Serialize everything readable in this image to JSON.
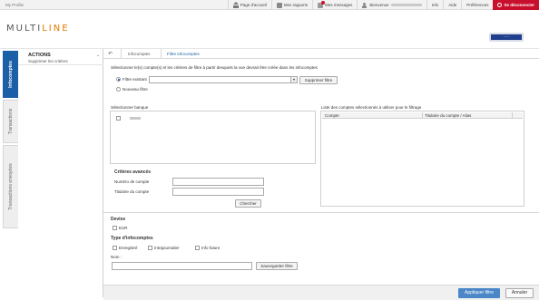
{
  "topbar": {
    "profile": "My Profile",
    "nav": [
      "Page d'accueil",
      "Mes rapports",
      "Mes messages",
      "Bienvenue",
      "Info",
      "Aide",
      "Préférences",
      "Se déconnecter"
    ]
  },
  "brand": {
    "part1": "MULTI",
    "part2": "LINE",
    "accent_color": "#e07b00",
    "button": "······"
  },
  "tabs": [
    "Infocomptes",
    "Transactions",
    "Transactions envoyées"
  ],
  "actions": {
    "title": "ACTIONS",
    "subtitle": "Supprimer les critères"
  },
  "breadcrumb": {
    "back": "↶",
    "items": [
      "Infocomptes",
      "Filtre Infocomptes"
    ]
  },
  "form": {
    "intro": "Sélectionner le(s) compte(s) et les critères de filtre à partir desquels la vue devrait être créée dans les infocomptes",
    "radio_existing": "Filtre existant",
    "radio_new": "Nouveau filtre",
    "filter_select_value": "",
    "delete_filter_button": "Supprimer filtre",
    "select_bank_title": "Sélectionner banque",
    "accounts_title": "Liste des comptes sélectionnés à utiliser pour le filtrage",
    "table_cols": [
      "Compte",
      "Titulaire du compte / Alias"
    ],
    "advanced_title": "Critères avancés",
    "account_number_label": "Numéro de compte",
    "account_holder_label": "Titulaire du compte",
    "search_button": "Chercher",
    "currency_title": "Devise",
    "currency_option": "EUR",
    "type_title": "Type d'infocomptes",
    "type_options": [
      "Enregistré",
      "Intrajournalier",
      "Info future"
    ],
    "name_label": "Nom :",
    "save_filter_button": "Sauvegarder filtre"
  },
  "footer": {
    "apply": "Appliquer filtre",
    "cancel": "Annuler"
  }
}
